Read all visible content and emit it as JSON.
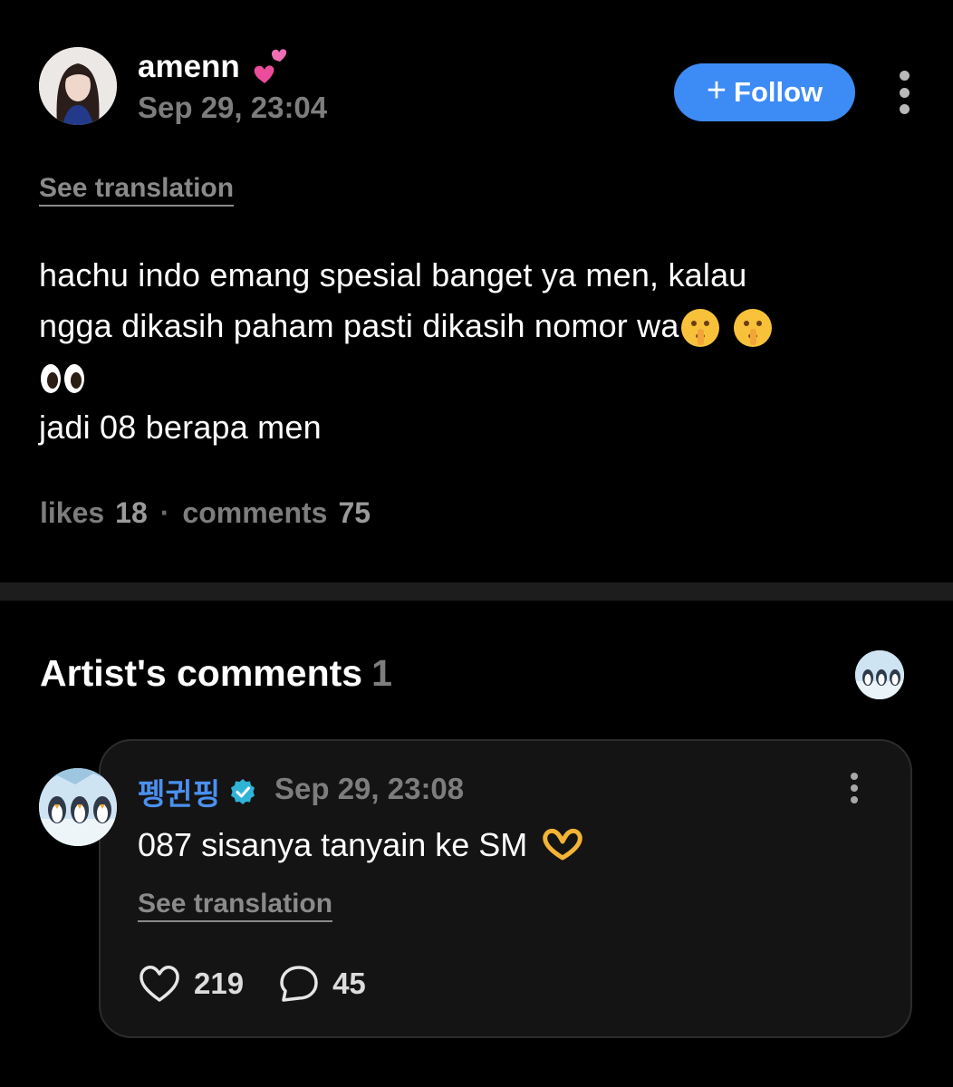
{
  "post": {
    "author": "amenn",
    "author_emoji": "heart-icon",
    "date": "Sep 29, 23:04",
    "follow_label": "Follow",
    "see_translation": "See translation",
    "body_line1": "hachu indo emang spesial banget ya men, kalau",
    "body_line2": "ngga dikasih paham pasti dikasih nomor wa",
    "body_line4": "jadi 08 berapa men",
    "likes_label": "likes",
    "likes_count": "18",
    "separator": "·",
    "comments_label": "comments",
    "comments_count": "75"
  },
  "artist_section": {
    "title": "Artist's comments",
    "count": "1"
  },
  "comment": {
    "author": "펭귄핑",
    "date": "Sep 29, 23:08",
    "text": "087 sisanya tanyain ke SM",
    "see_translation": "See translation",
    "like_count": "219",
    "reply_count": "45"
  },
  "colors": {
    "background": "#000000",
    "accent_blue": "#3d8bf5",
    "artist_name": "#4a90f0",
    "muted": "#7d7d7d",
    "card": "#141414"
  }
}
